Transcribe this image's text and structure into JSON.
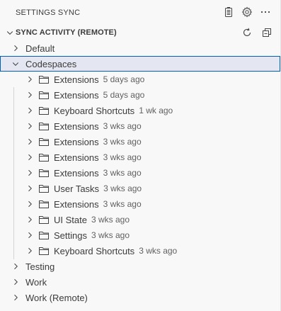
{
  "header": {
    "title": "SETTINGS SYNC"
  },
  "section": {
    "title": "SYNC ACTIVITY (REMOTE)"
  },
  "tree": {
    "top": [
      {
        "label": "Default"
      },
      {
        "label": "Codespaces"
      }
    ],
    "children": [
      {
        "label": "Extensions",
        "time": "5 days ago"
      },
      {
        "label": "Extensions",
        "time": "5 days ago"
      },
      {
        "label": "Keyboard Shortcuts",
        "time": "1 wk ago"
      },
      {
        "label": "Extensions",
        "time": "3 wks ago"
      },
      {
        "label": "Extensions",
        "time": "3 wks ago"
      },
      {
        "label": "Extensions",
        "time": "3 wks ago"
      },
      {
        "label": "Extensions",
        "time": "3 wks ago"
      },
      {
        "label": "User Tasks",
        "time": "3 wks ago"
      },
      {
        "label": "Extensions",
        "time": "3 wks ago"
      },
      {
        "label": "UI State",
        "time": "3 wks ago"
      },
      {
        "label": "Settings",
        "time": "3 wks ago"
      },
      {
        "label": "Keyboard Shortcuts",
        "time": "3 wks ago"
      }
    ],
    "bottom": [
      {
        "label": "Testing"
      },
      {
        "label": "Work"
      },
      {
        "label": "Work (Remote)"
      }
    ]
  },
  "icons": {
    "header_actions": [
      "clipboard-list-icon",
      "gear-icon",
      "more-icon"
    ],
    "section_actions": [
      "refresh-icon",
      "collapse-all-icon"
    ],
    "tree": [
      "chevron-right-icon",
      "chevron-down-icon",
      "folder-icon"
    ]
  },
  "colors": {
    "selection_border": "#005fb8",
    "selection_bg": "#e4e6f1"
  }
}
